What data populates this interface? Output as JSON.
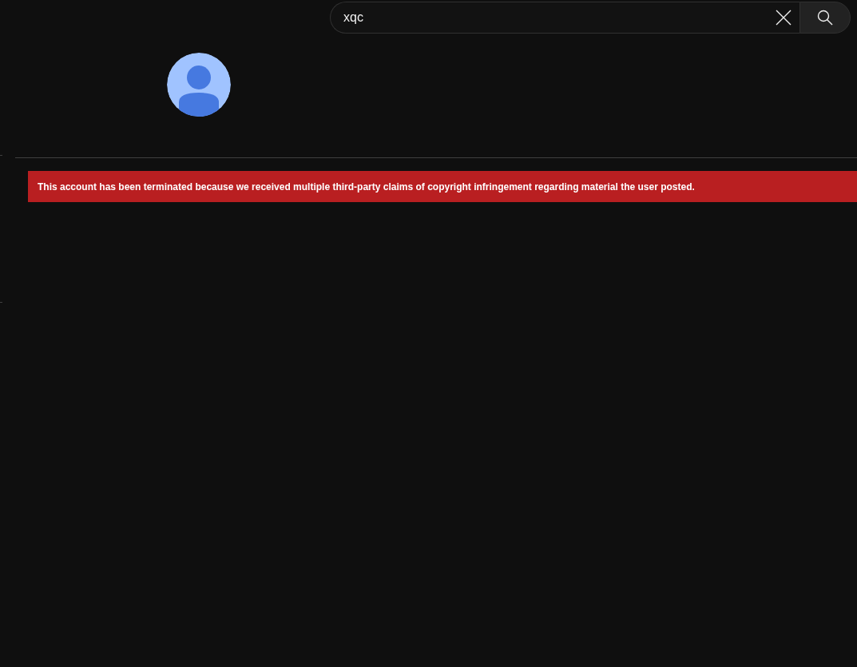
{
  "search": {
    "value": "xqc"
  },
  "banner": {
    "message": "This account has been terminated because we received multiple third-party claims of copyright infringement regarding material the user posted."
  }
}
